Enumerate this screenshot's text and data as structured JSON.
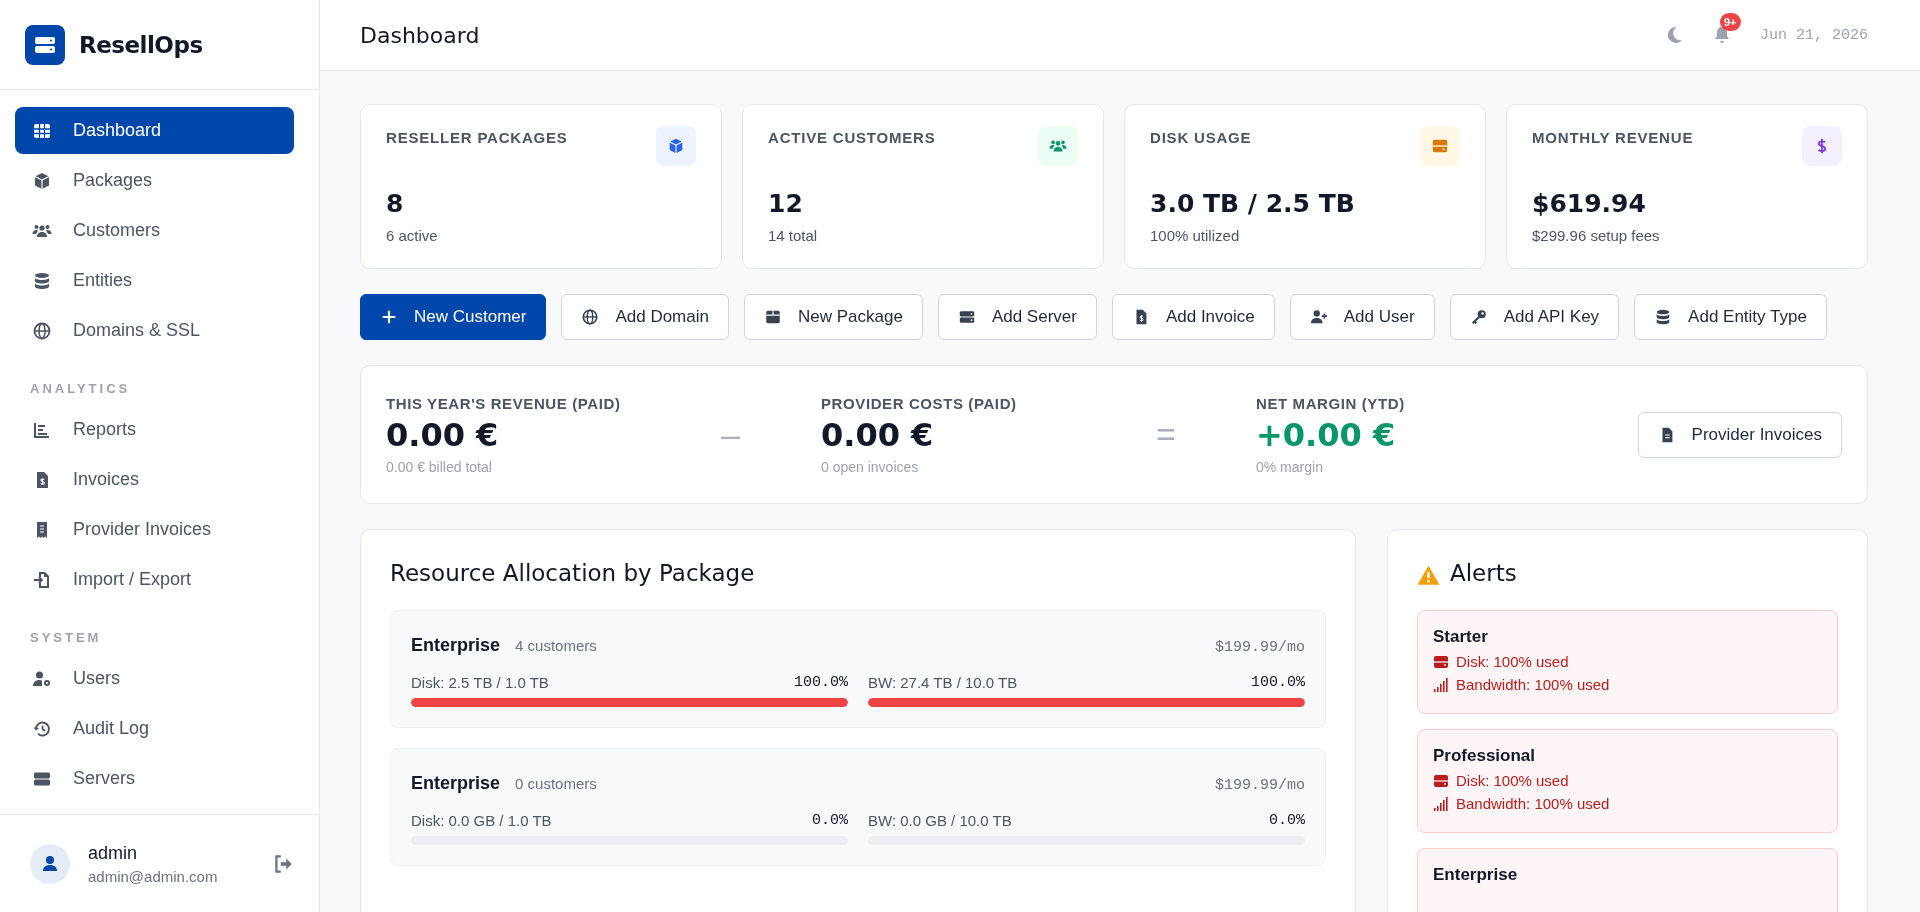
{
  "brand": {
    "name": "ResellOps"
  },
  "sidebar": {
    "sections": [
      {
        "items": [
          {
            "label": "Dashboard",
            "kind": "grid",
            "selected": true
          },
          {
            "label": "Packages",
            "kind": "box",
            "selected": false
          },
          {
            "label": "Customers",
            "kind": "users",
            "selected": false
          },
          {
            "label": "Entities",
            "kind": "db",
            "selected": false
          },
          {
            "label": "Domains & SSL",
            "kind": "globe",
            "selected": false
          }
        ]
      },
      {
        "heading": "ANALYTICS",
        "items": [
          {
            "label": "Reports",
            "kind": "chart",
            "selected": false
          },
          {
            "label": "Invoices",
            "kind": "invoice",
            "selected": false
          },
          {
            "label": "Provider Invoices",
            "kind": "receipt",
            "selected": false
          },
          {
            "label": "Import / Export",
            "kind": "import",
            "selected": false
          }
        ]
      },
      {
        "heading": "SYSTEM",
        "items": [
          {
            "label": "Users",
            "kind": "usergear",
            "selected": false
          },
          {
            "label": "Audit Log",
            "kind": "history",
            "selected": false
          },
          {
            "label": "Servers",
            "kind": "server",
            "selected": false
          }
        ]
      }
    ]
  },
  "user": {
    "name": "admin",
    "email": "admin@admin.com"
  },
  "header": {
    "title": "Dashboard",
    "notification_badge": "9+",
    "date": "Jun 21, 2026"
  },
  "stats": [
    {
      "label": "RESELLER PACKAGES",
      "value": "8",
      "sub": "6 active",
      "kind": "packages"
    },
    {
      "label": "ACTIVE CUSTOMERS",
      "value": "12",
      "sub": "14 total",
      "kind": "customers"
    },
    {
      "label": "DISK USAGE",
      "value": "3.0 TB / 2.5 TB",
      "sub": "100% utilized",
      "kind": "disk"
    },
    {
      "label": "MONTHLY REVENUE",
      "value": "$619.94",
      "sub": "$299.96 setup fees",
      "kind": "revenue"
    }
  ],
  "actions": [
    {
      "label": "New Customer",
      "kind": "plus",
      "primary": true
    },
    {
      "label": "Add Domain",
      "kind": "globe",
      "primary": false
    },
    {
      "label": "New Package",
      "kind": "box",
      "primary": false
    },
    {
      "label": "Add Server",
      "kind": "server",
      "primary": false
    },
    {
      "label": "Add Invoice",
      "kind": "invoice",
      "primary": false
    },
    {
      "label": "Add User",
      "kind": "useradd",
      "primary": false
    },
    {
      "label": "Add API Key",
      "kind": "key",
      "primary": false
    },
    {
      "label": "Add Entity Type",
      "kind": "db",
      "primary": false
    }
  ],
  "finance": {
    "metrics": [
      {
        "label": "THIS YEAR'S REVENUE (PAID)",
        "value": "0.00 €",
        "sub": "0.00 € billed total",
        "kind": "plain"
      },
      {
        "operator": "–",
        "label": "PROVIDER COSTS (PAID)",
        "value": "0.00 €",
        "sub": "0 open invoices",
        "kind": "plain"
      },
      {
        "operator": "=",
        "label": "NET MARGIN (YTD)",
        "value": "+0.00 €",
        "sub": "0% margin",
        "kind": "gain"
      }
    ],
    "button": "Provider Invoices"
  },
  "resources": {
    "title": "Resource Allocation by Package",
    "packages": [
      {
        "name": "Enterprise",
        "customers": "4 customers",
        "price": "$199.99/mo",
        "meters": [
          {
            "label": "Disk: 2.5 TB / 1.0 TB",
            "reading": "100.0%",
            "level": 1
          },
          {
            "label": "BW: 27.4 TB / 10.0 TB",
            "reading": "100.0%",
            "level": 1
          }
        ]
      },
      {
        "name": "Enterprise",
        "customers": "0 customers",
        "price": "$199.99/mo",
        "meters": [
          {
            "label": "Disk: 0.0 GB / 1.0 TB",
            "reading": "0.0%",
            "level": 0
          },
          {
            "label": "BW: 0.0 GB / 10.0 TB",
            "reading": "0.0%",
            "level": 0
          }
        ]
      }
    ]
  },
  "alerts": {
    "title": "Alerts",
    "items": [
      {
        "name": "Starter",
        "lines": [
          {
            "kind": "disk",
            "text": "Disk: 100% used"
          },
          {
            "kind": "bandwidth",
            "text": "Bandwidth: 100% used"
          }
        ]
      },
      {
        "name": "Professional",
        "lines": [
          {
            "kind": "disk",
            "text": "Disk: 100% used"
          },
          {
            "kind": "bandwidth",
            "text": "Bandwidth: 100% used"
          }
        ]
      },
      {
        "name": "Enterprise"
      }
    ]
  }
}
